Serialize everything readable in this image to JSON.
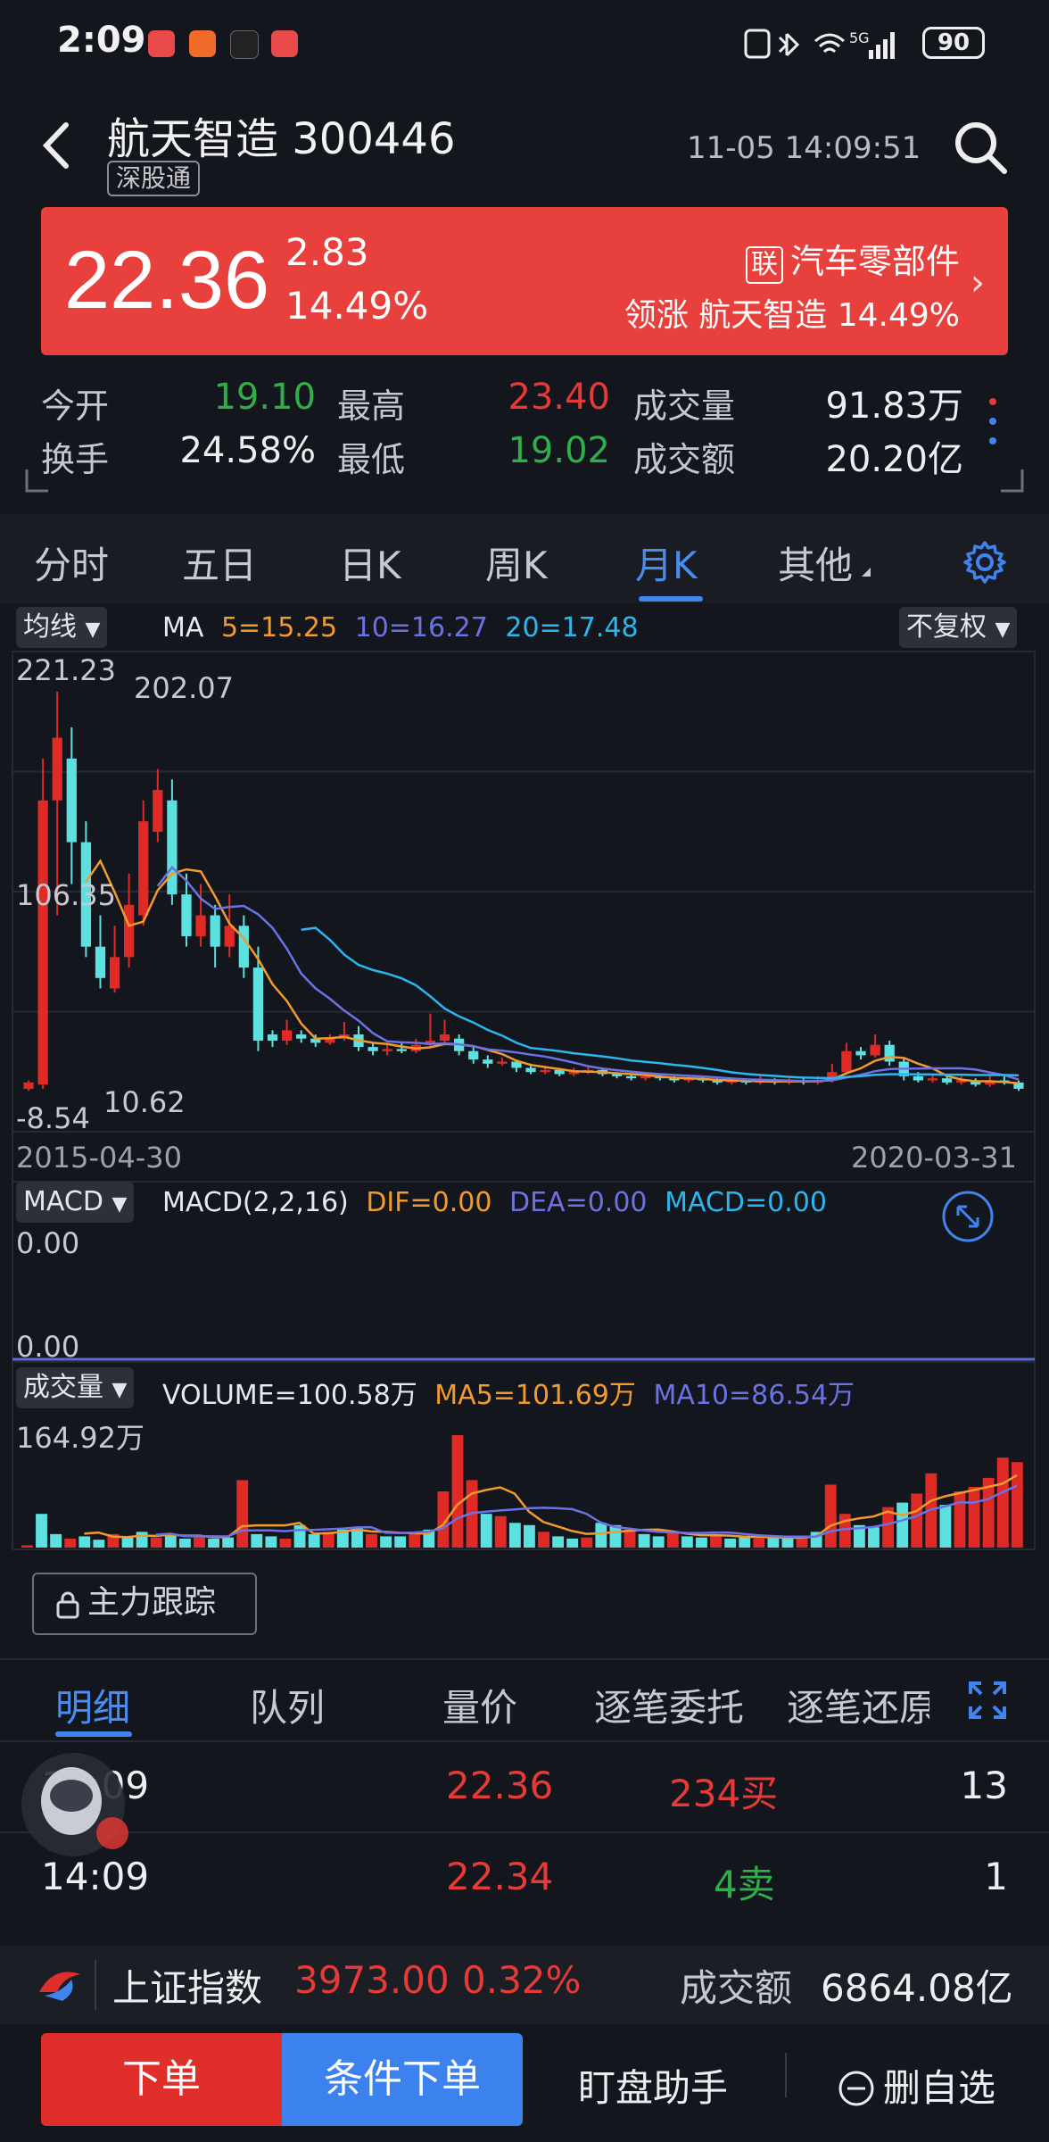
{
  "status": {
    "time": "2:09",
    "battery": "90",
    "network": "5G"
  },
  "header": {
    "name_code": "航天智造 300446",
    "board": "深股通",
    "datetime": "11-05 14:09:51"
  },
  "price": {
    "last": "22.36",
    "change": "2.83",
    "change_pct": "14.49%",
    "sector_badge": "联",
    "sector": "汽车零部件",
    "lead_text": "领涨 航天智造 14.49%"
  },
  "quote": {
    "open_label": "今开",
    "open": "19.10",
    "high_label": "最高",
    "high": "23.40",
    "vol_label": "成交量",
    "vol": "91.83万",
    "turnover_label": "换手",
    "turnover": "24.58%",
    "low_label": "最低",
    "low": "19.02",
    "amt_label": "成交额",
    "amt": "20.20亿"
  },
  "tabs": [
    "分时",
    "五日",
    "日K",
    "周K",
    "月K",
    "其他"
  ],
  "kline": {
    "ma_dropdown": "均线",
    "ma_title": "MA",
    "ma5": "5=15.25",
    "ma10": "10=16.27",
    "ma20": "20=17.48",
    "adjust": "不复权",
    "y_top": "221.23",
    "y_mid": "106.35",
    "y_bottom": "-8.54",
    "max_label": "202.07",
    "min_label": "10.62",
    "date_start": "2015-04-30",
    "date_end": "2020-03-31",
    "colors": {
      "ma5": "#f39a2c",
      "ma10": "#6b72e4",
      "ma20": "#2cb6ee",
      "up": "#e02a26",
      "down": "#5ce0e0"
    }
  },
  "macd": {
    "dropdown": "MACD",
    "title": "MACD(2,2,16)",
    "dif": "DIF=0.00",
    "dea": "DEA=0.00",
    "macd": "MACD=0.00",
    "y_top": "0.00",
    "y_bottom": "0.00"
  },
  "volume": {
    "dropdown": "成交量",
    "vol": "VOLUME=100.58万",
    "ma5": "MA5=101.69万",
    "ma10": "MA10=86.54万",
    "y_top": "164.92万"
  },
  "tracking_button": "主力跟踪",
  "detail_tabs": [
    "明细",
    "队列",
    "量价",
    "逐笔委托",
    "逐笔还原"
  ],
  "trades": [
    {
      "time": "14:09",
      "price": "22.36",
      "volume": "234买",
      "count": "13"
    },
    {
      "time": "14:09",
      "price": "22.34",
      "volume": "4卖",
      "count": "1"
    }
  ],
  "index_bar": {
    "name": "上证指数",
    "value": "3973.00",
    "pct": "0.32%",
    "amt_label": "成交额",
    "amt": "6864.08亿"
  },
  "actions": {
    "order": "下单",
    "cond_order": "条件下单",
    "helper": "盯盘助手",
    "remove": "删自选"
  },
  "chart_data": {
    "type": "candlestick",
    "x_range": [
      "2015-04-30",
      "2020-03-31"
    ],
    "ylim": [
      -8.54,
      221.23
    ],
    "max_high": 202.07,
    "min_low": 10.62,
    "series": [
      {
        "name": "MA5",
        "last": 15.25
      },
      {
        "name": "MA10",
        "last": 16.27
      },
      {
        "name": "MA20",
        "last": 17.48
      }
    ],
    "volume_ylim_label": "164.92万"
  }
}
